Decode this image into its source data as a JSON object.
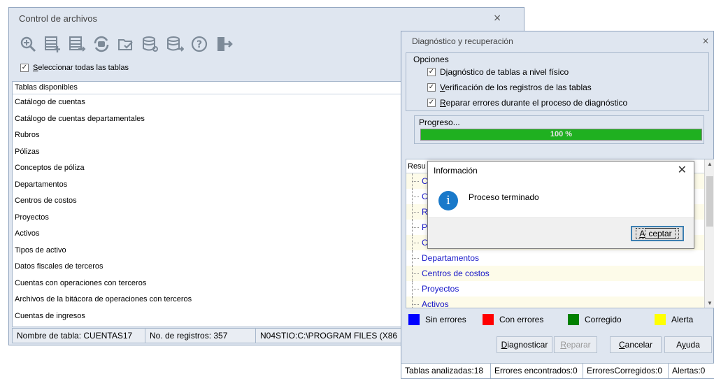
{
  "win1": {
    "title": "Control de archivos",
    "close_glyph": "⨯",
    "toolbar_icons": [
      "zoom-icon",
      "add-table-icon",
      "export-table-icon",
      "refresh-db-icon",
      "folder-check-icon",
      "db-search-icon",
      "db-export-icon",
      "help-icon",
      "exit-icon"
    ],
    "select_all": {
      "checked": true,
      "label_first": "S",
      "label_rest": "eleccionar todas las tablas"
    },
    "list_header": "Tablas disponibles",
    "tables": [
      "Catálogo de cuentas",
      "Catálogo de cuentas departamentales",
      "Rubros",
      "Pólizas",
      "Conceptos de póliza",
      "Departamentos",
      "Centros de costos",
      "Proyectos",
      "Activos",
      "Tipos de activo",
      "Datos fiscales de terceros",
      "Cuentas con operaciones con terceros",
      "Archivos de la bitácora de operaciones con terceros",
      "Cuentas de ingresos"
    ],
    "status": {
      "table_name": "Nombre de tabla: CUENTAS17",
      "records": "No. de registros: 357",
      "path": "N04STIO:C:\\PROGRAM FILES (X86"
    }
  },
  "win2": {
    "title": "Diagnóstico y recuperación",
    "close_glyph": "⨯",
    "options_label": "Opciones",
    "options": [
      {
        "pre": "D",
        "ul": "i",
        "post": "agnóstico de  tablas a nivel físico",
        "checked": true
      },
      {
        "pre": "",
        "ul": "V",
        "post": "erificación de los registros de las tablas",
        "checked": true
      },
      {
        "pre": "",
        "ul": "R",
        "post": "eparar errores durante el proceso de diagnóstico",
        "checked": true
      }
    ],
    "progress_label": "Progreso...",
    "progress_value": 1.0,
    "progress_text": "100 %",
    "results_header": "Resu",
    "result_items": [
      "C",
      "C",
      "R",
      "P",
      "C",
      "Departamentos",
      "Centros de costos",
      "Proyectos",
      "Activos"
    ],
    "legend": [
      {
        "label": "Sin errores",
        "color": "#0000ff"
      },
      {
        "label": "Con errores",
        "color": "#ff0000"
      },
      {
        "label": "Corregido",
        "color": "#008000"
      },
      {
        "label": "Alerta",
        "color": "#ffff00"
      }
    ],
    "buttons": {
      "diagnosticar": {
        "ul": "D",
        "rest": "iagnosticar"
      },
      "reparar": {
        "ul": "R",
        "rest": "eparar"
      },
      "cancelar": {
        "ul": "C",
        "rest": "ancelar"
      },
      "ayuda": {
        "pre": "A",
        "ul": "y",
        "rest": "uda"
      }
    },
    "status": {
      "analyzed": "Tablas analizadas:18",
      "errors": "Errores encontrados:0",
      "corrected": "ErroresCorregidos:0",
      "alerts": "Alertas:0"
    }
  },
  "dialog": {
    "title": "Información",
    "close_glyph": "✕",
    "icon_glyph": "i",
    "message": "Proceso terminado",
    "ok": {
      "ul": "A",
      "rest": "ceptar"
    }
  }
}
